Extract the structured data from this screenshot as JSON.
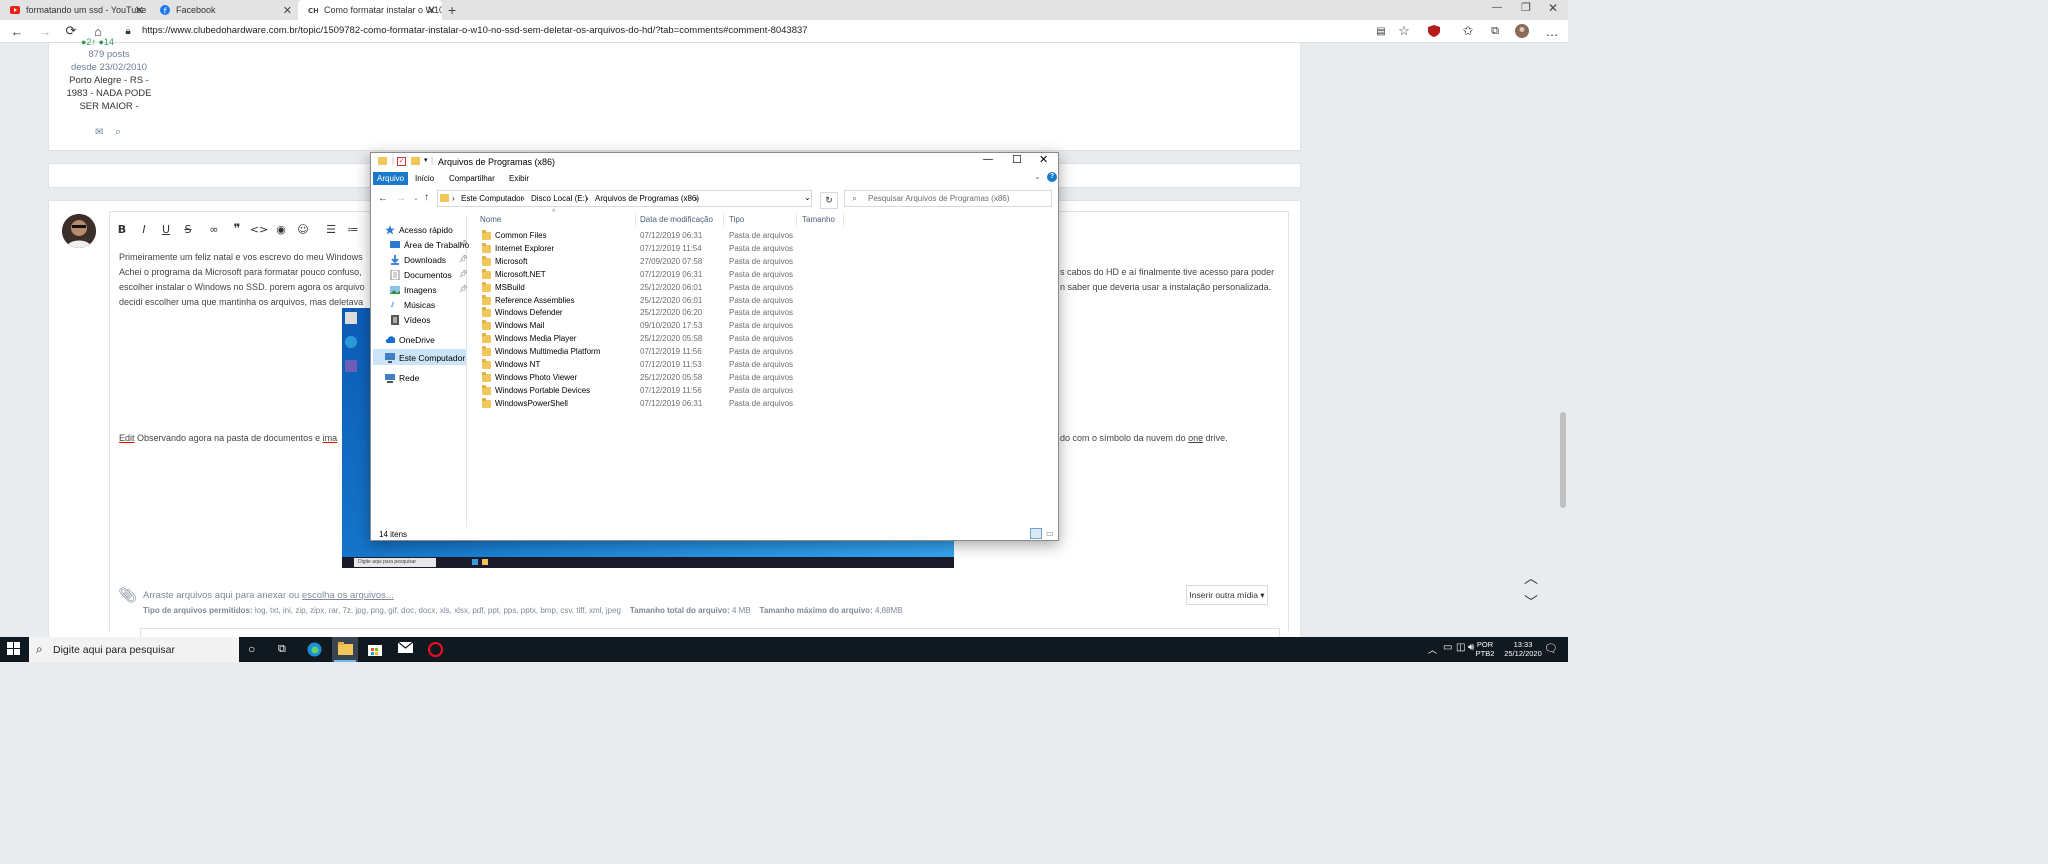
{
  "browser": {
    "tabs": [
      {
        "title": "formatando um ssd - YouTube",
        "icon": "youtube-icon"
      },
      {
        "title": "Facebook",
        "icon": "facebook-icon"
      },
      {
        "title": "Como formatar instalar o W10 n",
        "icon": "clubedohardware-icon"
      }
    ],
    "url": "https://www.clubedohardware.com.br/topic/1509782-como-formatar-instalar-o-w10-no-ssd-sem-deletar-os-arquivos-do-hd/?tab=comments#comment-8043837"
  },
  "profile": {
    "posts": "879 posts",
    "since": "desde 23/02/2010",
    "location_line1": "Porto Alegre - RS -",
    "location_line2": "1983 - NADA PODE",
    "location_line3": "SER MAIOR -"
  },
  "post": {
    "line1": "Primeiramente um feliz natal e vos escrevo do meu Windows",
    "line2": "Achei o programa da Microsoft para formatar pouco confuso,",
    "line2_right": "s cabos do HD e aí finalmente tive acesso para poder",
    "line3": "escolher instalar o Windows no SSD. porem agora os arquivo",
    "line3_right": "n saber que deveria usar a instalação personalizada.",
    "line4": "decidi escolher uma que mantinha os arquivos, mas deletava",
    "edit_left": "Observando agora na pasta de documentos e",
    "edit_word": "Edit",
    "edit_ima": "ima",
    "edit_right_a": "do com o símbolo da nuvem do",
    "edit_right_link": "one",
    "edit_right_b": "drive."
  },
  "explorer": {
    "title": "Arquivos de Programas (x86)",
    "ribbon_tabs": [
      "Arquivo",
      "Início",
      "Compartilhar",
      "Exibir"
    ],
    "breadcrumb": [
      "Este Computador",
      "Disco Local (E:)",
      "Arquivos de Programas (x86)"
    ],
    "search_placeholder": "Pesquisar Arquivos de Programas (x86)",
    "nav": [
      {
        "label": "Acesso rápido",
        "icon": "star-icon"
      },
      {
        "label": "Área de Trabalho",
        "icon": "desktop-icon"
      },
      {
        "label": "Downloads",
        "icon": "download-icon"
      },
      {
        "label": "Documentos",
        "icon": "document-icon"
      },
      {
        "label": "Imagens",
        "icon": "image-icon"
      },
      {
        "label": "Músicas",
        "icon": "music-icon"
      },
      {
        "label": "Vídeos",
        "icon": "video-icon"
      },
      {
        "label": "OneDrive",
        "icon": "cloud-icon"
      },
      {
        "label": "Este Computador",
        "icon": "computer-icon"
      },
      {
        "label": "Rede",
        "icon": "network-icon"
      }
    ],
    "columns": [
      "Nome",
      "Data de modificação",
      "Tipo",
      "Tamanho"
    ],
    "files": [
      {
        "name": "Common Files",
        "date": "07/12/2019 06:31",
        "type": "Pasta de arquivos"
      },
      {
        "name": "Internet Explorer",
        "date": "07/12/2019 11:54",
        "type": "Pasta de arquivos"
      },
      {
        "name": "Microsoft",
        "date": "27/09/2020 07:58",
        "type": "Pasta de arquivos"
      },
      {
        "name": "Microsoft.NET",
        "date": "07/12/2019 06:31",
        "type": "Pasta de arquivos"
      },
      {
        "name": "MSBuild",
        "date": "25/12/2020 06:01",
        "type": "Pasta de arquivos"
      },
      {
        "name": "Reference Assemblies",
        "date": "25/12/2020 06:01",
        "type": "Pasta de arquivos"
      },
      {
        "name": "Windows Defender",
        "date": "25/12/2020 06:20",
        "type": "Pasta de arquivos"
      },
      {
        "name": "Windows Mail",
        "date": "09/10/2020 17:53",
        "type": "Pasta de arquivos"
      },
      {
        "name": "Windows Media Player",
        "date": "25/12/2020 05:58",
        "type": "Pasta de arquivos"
      },
      {
        "name": "Windows Multimedia Platform",
        "date": "07/12/2019 11:56",
        "type": "Pasta de arquivos"
      },
      {
        "name": "Windows NT",
        "date": "07/12/2019 11:53",
        "type": "Pasta de arquivos"
      },
      {
        "name": "Windows Photo Viewer",
        "date": "25/12/2020 05:58",
        "type": "Pasta de arquivos"
      },
      {
        "name": "Windows Portable Devices",
        "date": "07/12/2019 11:56",
        "type": "Pasta de arquivos"
      },
      {
        "name": "WindowsPowerShell",
        "date": "07/12/2019 06:31",
        "type": "Pasta de arquivos"
      }
    ],
    "status": "14 itens"
  },
  "embedded": {
    "search_text": "Digite aqui para pesquisar"
  },
  "attachments": {
    "drop_text": "Arraste arquivos aqui para anexar ou",
    "choose_link": "escolha os arquivos...",
    "allowed_label": "Tipo de arquivos permitidos:",
    "allowed_types": "log, txt, ini, zip, zipx, rar, 7z, jpg, png, gif, doc, docx, xls, xlsx, pdf, ppt, pps, pptx, bmp, csv, tiff, xml, jpeg",
    "total_label": "Tamanho total do arquivo:",
    "total_value": "4 MB",
    "max_label": "Tamanho máximo do arquivo:",
    "max_value": "4,88MB",
    "insert_media": "Inserir outra mídia ▾"
  },
  "taskbar": {
    "search_placeholder": "Digite aqui para pesquisar",
    "lang_line1": "POR",
    "lang_line2": "PTB2",
    "time": "13:33",
    "date": "25/12/2020"
  },
  "colors": {
    "accent": "#1979ca",
    "taskbar": "#101820",
    "folder": "#f1c65b",
    "link": "#4a6a8a"
  }
}
